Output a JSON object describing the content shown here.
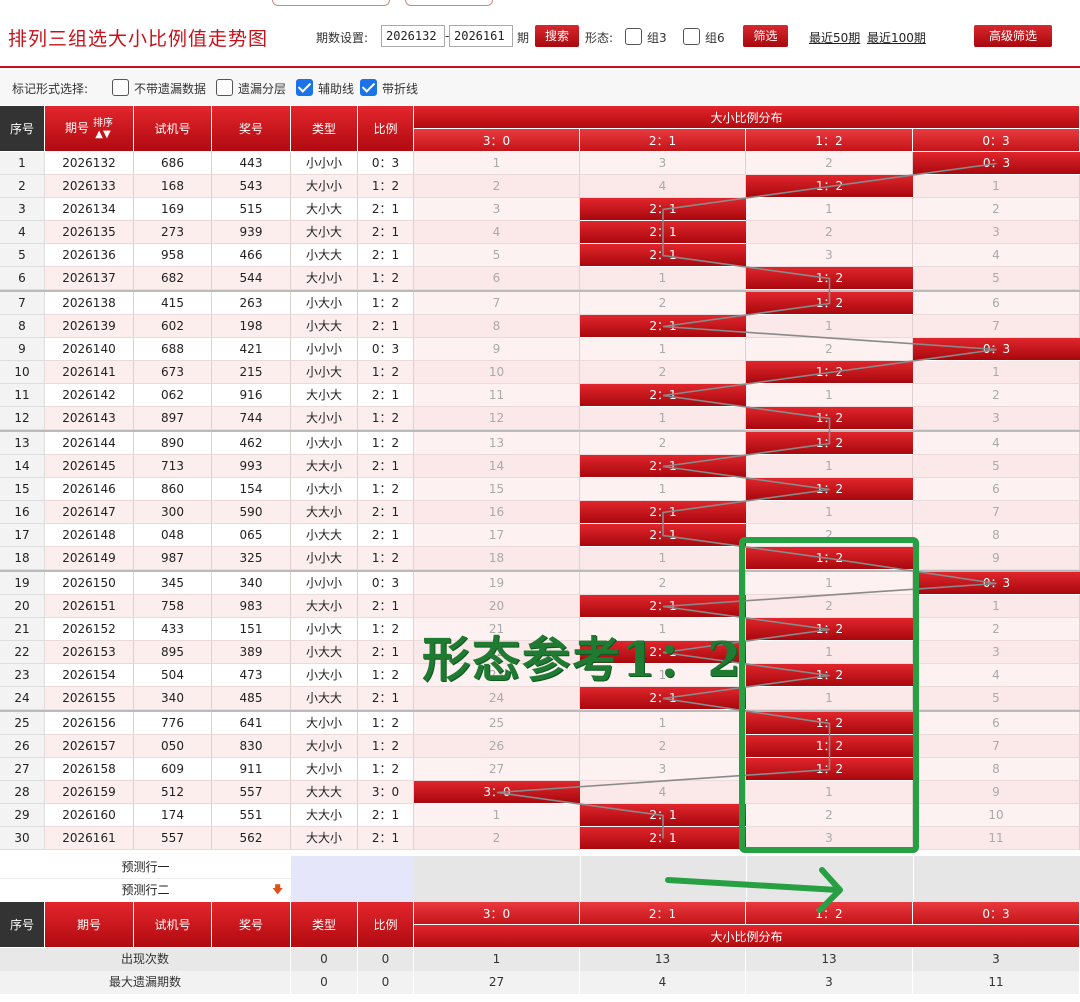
{
  "header": {
    "title": "排列三组选大小比例值走势图",
    "period_label": "期数设置:",
    "period_from": "2026132",
    "period_to": "2026161",
    "period_unit": "期",
    "search_label": "搜索",
    "form_label": "形态:",
    "group3_label": "组3",
    "group6_label": "组6",
    "filter_label": "筛选",
    "recent50_label": "最近50期",
    "recent100_label": "最近100期",
    "advanced_label": "高级筛选"
  },
  "marks": {
    "label": "标记形式选择:",
    "no_missing": "不带遗漏数据",
    "layered": "遗漏分层",
    "aux_line": "辅助线",
    "polyline": "带折线"
  },
  "table": {
    "headers": {
      "seq": "序号",
      "issue": "期号",
      "sort": "排序",
      "test": "试机号",
      "prize": "奖号",
      "type": "类型",
      "ratio": "比例",
      "dist": "大小比例分布"
    },
    "ratio_cols": [
      "3：0",
      "2：1",
      "1：2",
      "0：3"
    ],
    "rows": [
      {
        "seq": "1",
        "issue": "2026132",
        "test": "686",
        "prize": "443",
        "type": "小小小",
        "ratio": "0：3",
        "d": [
          "1",
          "3",
          "2",
          "0：3"
        ],
        "hit": 3
      },
      {
        "seq": "2",
        "issue": "2026133",
        "test": "168",
        "prize": "543",
        "type": "大小小",
        "ratio": "1：2",
        "d": [
          "2",
          "4",
          "1：2",
          "1"
        ],
        "hit": 2
      },
      {
        "seq": "3",
        "issue": "2026134",
        "test": "169",
        "prize": "515",
        "type": "大小大",
        "ratio": "2：1",
        "d": [
          "3",
          "2：1",
          "1",
          "2"
        ],
        "hit": 1
      },
      {
        "seq": "4",
        "issue": "2026135",
        "test": "273",
        "prize": "939",
        "type": "大小大",
        "ratio": "2：1",
        "d": [
          "4",
          "2：1",
          "2",
          "3"
        ],
        "hit": 1
      },
      {
        "seq": "5",
        "issue": "2026136",
        "test": "958",
        "prize": "466",
        "type": "小大大",
        "ratio": "2：1",
        "d": [
          "5",
          "2：1",
          "3",
          "4"
        ],
        "hit": 1
      },
      {
        "seq": "6",
        "issue": "2026137",
        "test": "682",
        "prize": "544",
        "type": "大小小",
        "ratio": "1：2",
        "d": [
          "6",
          "1",
          "1：2",
          "5"
        ],
        "hit": 2
      },
      {
        "seq": "7",
        "issue": "2026138",
        "test": "415",
        "prize": "263",
        "type": "小大小",
        "ratio": "1：2",
        "d": [
          "7",
          "2",
          "1：2",
          "6"
        ],
        "hit": 2
      },
      {
        "seq": "8",
        "issue": "2026139",
        "test": "602",
        "prize": "198",
        "type": "小大大",
        "ratio": "2：1",
        "d": [
          "8",
          "2：1",
          "1",
          "7"
        ],
        "hit": 1
      },
      {
        "seq": "9",
        "issue": "2026140",
        "test": "688",
        "prize": "421",
        "type": "小小小",
        "ratio": "0：3",
        "d": [
          "9",
          "1",
          "2",
          "0：3"
        ],
        "hit": 3
      },
      {
        "seq": "10",
        "issue": "2026141",
        "test": "673",
        "prize": "215",
        "type": "小小大",
        "ratio": "1：2",
        "d": [
          "10",
          "2",
          "1：2",
          "1"
        ],
        "hit": 2
      },
      {
        "seq": "11",
        "issue": "2026142",
        "test": "062",
        "prize": "916",
        "type": "大小大",
        "ratio": "2：1",
        "d": [
          "11",
          "2：1",
          "1",
          "2"
        ],
        "hit": 1
      },
      {
        "seq": "12",
        "issue": "2026143",
        "test": "897",
        "prize": "744",
        "type": "大小小",
        "ratio": "1：2",
        "d": [
          "12",
          "1",
          "1：2",
          "3"
        ],
        "hit": 2
      },
      {
        "seq": "13",
        "issue": "2026144",
        "test": "890",
        "prize": "462",
        "type": "小大小",
        "ratio": "1：2",
        "d": [
          "13",
          "2",
          "1：2",
          "4"
        ],
        "hit": 2
      },
      {
        "seq": "14",
        "issue": "2026145",
        "test": "713",
        "prize": "993",
        "type": "大大小",
        "ratio": "2：1",
        "d": [
          "14",
          "2：1",
          "1",
          "5"
        ],
        "hit": 1
      },
      {
        "seq": "15",
        "issue": "2026146",
        "test": "860",
        "prize": "154",
        "type": "小大小",
        "ratio": "1：2",
        "d": [
          "15",
          "1",
          "1：2",
          "6"
        ],
        "hit": 2
      },
      {
        "seq": "16",
        "issue": "2026147",
        "test": "300",
        "prize": "590",
        "type": "大大小",
        "ratio": "2：1",
        "d": [
          "16",
          "2：1",
          "1",
          "7"
        ],
        "hit": 1
      },
      {
        "seq": "17",
        "issue": "2026148",
        "test": "048",
        "prize": "065",
        "type": "小大大",
        "ratio": "2：1",
        "d": [
          "17",
          "2：1",
          "2",
          "8"
        ],
        "hit": 1
      },
      {
        "seq": "18",
        "issue": "2026149",
        "test": "987",
        "prize": "325",
        "type": "小小大",
        "ratio": "1：2",
        "d": [
          "18",
          "1",
          "1：2",
          "9"
        ],
        "hit": 2
      },
      {
        "seq": "19",
        "issue": "2026150",
        "test": "345",
        "prize": "340",
        "type": "小小小",
        "ratio": "0：3",
        "d": [
          "19",
          "2",
          "1",
          "0：3"
        ],
        "hit": 3
      },
      {
        "seq": "20",
        "issue": "2026151",
        "test": "758",
        "prize": "983",
        "type": "大大小",
        "ratio": "2：1",
        "d": [
          "20",
          "2：1",
          "2",
          "1"
        ],
        "hit": 1
      },
      {
        "seq": "21",
        "issue": "2026152",
        "test": "433",
        "prize": "151",
        "type": "小小大",
        "ratio": "1：2",
        "d": [
          "21",
          "1",
          "1：2",
          "2"
        ],
        "hit": 2
      },
      {
        "seq": "22",
        "issue": "2026153",
        "test": "895",
        "prize": "389",
        "type": "小大大",
        "ratio": "2：1",
        "d": [
          "22",
          "2：1",
          "1",
          "3"
        ],
        "hit": 1
      },
      {
        "seq": "23",
        "issue": "2026154",
        "test": "504",
        "prize": "473",
        "type": "小大小",
        "ratio": "1：2",
        "d": [
          "23",
          "1",
          "1：2",
          "4"
        ],
        "hit": 2
      },
      {
        "seq": "24",
        "issue": "2026155",
        "test": "340",
        "prize": "485",
        "type": "小大大",
        "ratio": "2：1",
        "d": [
          "24",
          "2：1",
          "1",
          "5"
        ],
        "hit": 1
      },
      {
        "seq": "25",
        "issue": "2026156",
        "test": "776",
        "prize": "641",
        "type": "大小小",
        "ratio": "1：2",
        "d": [
          "25",
          "1",
          "1：2",
          "6"
        ],
        "hit": 2
      },
      {
        "seq": "26",
        "issue": "2026157",
        "test": "050",
        "prize": "830",
        "type": "大小小",
        "ratio": "1：2",
        "d": [
          "26",
          "2",
          "1：2",
          "7"
        ],
        "hit": 2
      },
      {
        "seq": "27",
        "issue": "2026158",
        "test": "609",
        "prize": "911",
        "type": "大小小",
        "ratio": "1：2",
        "d": [
          "27",
          "3",
          "1：2",
          "8"
        ],
        "hit": 2
      },
      {
        "seq": "28",
        "issue": "2026159",
        "test": "512",
        "prize": "557",
        "type": "大大大",
        "ratio": "3：0",
        "d": [
          "3：0",
          "4",
          "1",
          "9"
        ],
        "hit": 0
      },
      {
        "seq": "29",
        "issue": "2026160",
        "test": "174",
        "prize": "551",
        "type": "大大小",
        "ratio": "2：1",
        "d": [
          "1",
          "2：1",
          "2",
          "10"
        ],
        "hit": 1
      },
      {
        "seq": "30",
        "issue": "2026161",
        "test": "557",
        "prize": "562",
        "type": "大大小",
        "ratio": "2：1",
        "d": [
          "2",
          "2：1",
          "3",
          "11"
        ],
        "hit": 1
      }
    ],
    "predict1": "预测行一",
    "predict2": "预测行二",
    "stats": [
      {
        "label": "出现次数",
        "type": "0",
        "ratio": "0",
        "v": [
          "1",
          "13",
          "13",
          "3"
        ]
      },
      {
        "label": "最大遗漏期数",
        "type": "0",
        "ratio": "0",
        "v": [
          "27",
          "4",
          "3",
          "11"
        ]
      }
    ]
  },
  "overlay": {
    "text": "形态参考1：2",
    "color": "#1f9a3a"
  }
}
